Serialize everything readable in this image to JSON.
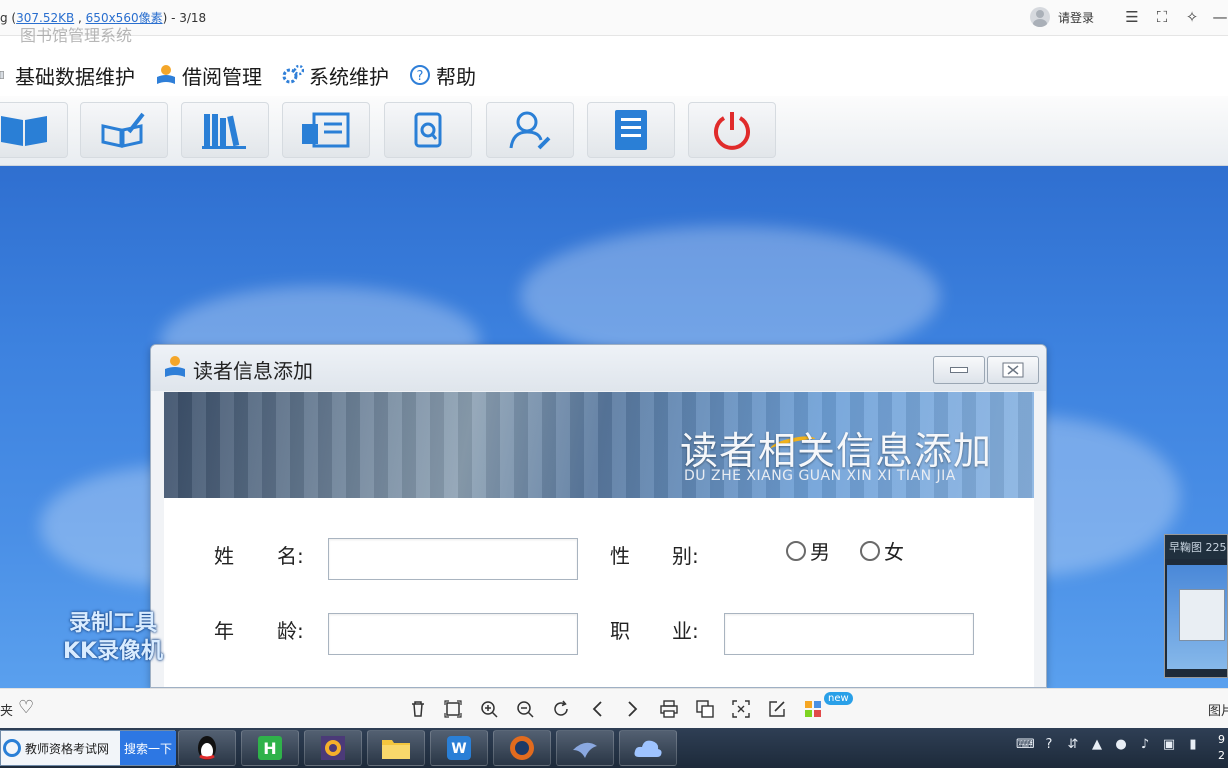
{
  "viewer": {
    "title_prefix": "g (",
    "file_size": "307.52KB",
    "sep": " , ",
    "dimensions": "650x560像素",
    "title_suffix": ") - 3/18",
    "login_label": "请登录",
    "bottom_left_label": "夹",
    "new_badge": "new",
    "bottom_right_label": "图片"
  },
  "app": {
    "title": "图书馆管理系统",
    "menu": [
      "基础数据维护",
      "借阅管理",
      "系统维护",
      "帮助"
    ]
  },
  "dialog": {
    "title": "读者信息添加",
    "banner_title": "读者相关信息添加",
    "banner_subtitle": "DU ZHE XIANG GUAN XIN XI TIAN JIA",
    "labels": {
      "name_1": "姓",
      "name_2": "名:",
      "gender_1": "性",
      "gender_2": "别:",
      "age_1": "年",
      "age_2": "龄:",
      "job_1": "职",
      "job_2": "业:"
    },
    "gender_options": [
      "男",
      "女"
    ],
    "fields": {
      "name": "",
      "age": "",
      "job": ""
    }
  },
  "watermark": {
    "line1": "录制工具",
    "line2": "KK录像机"
  },
  "thumbnail": {
    "label": "早鞠图 225"
  },
  "taskbar": {
    "search_text": "教师资格考试网",
    "search_button": "搜索一下",
    "clock_line1": "9",
    "clock_line2": "2"
  },
  "colors": {
    "desktop_blue": "#3d82df",
    "accent_blue": "#2d77e3",
    "power_red": "#e02b2b"
  }
}
